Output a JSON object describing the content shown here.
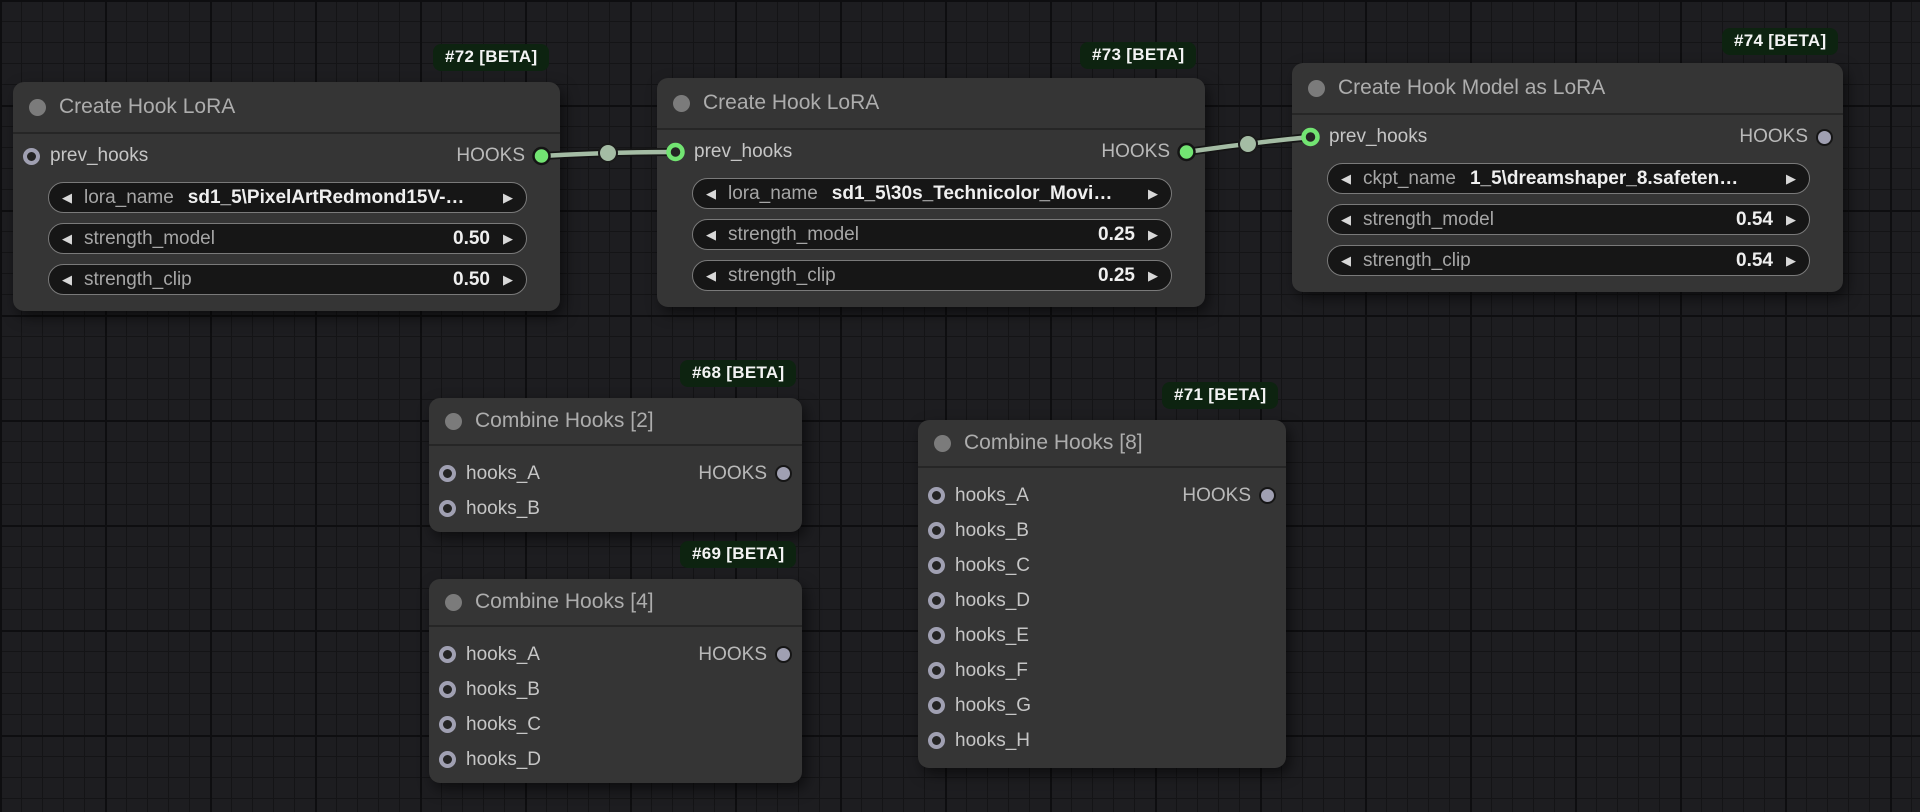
{
  "canvas": {
    "background": "#1d1d20",
    "grid_minor_line": "#141416",
    "grid_major_line": "#0e0e10"
  },
  "colors": {
    "node_bg": "#353535",
    "node_title_text": "#adadad",
    "badge_bg": "#0d2310",
    "badge_text": "#f4f4f4",
    "port_connected_green": "#72e472",
    "port_unconnected_grey": "#a0a0b2",
    "link_color": "#a4bca4",
    "widget_bg": "#161616",
    "widget_border": "#7a7a7a",
    "widget_label_text": "#a6a6a6",
    "widget_value_text": "#efefef",
    "slot_label_text": "#c6c6c6"
  },
  "icons": {
    "arrow_left": "◀",
    "arrow_right": "▶"
  },
  "nodes": [
    {
      "id": "#72",
      "badge": "#72 [BETA]",
      "title": "Create Hook LoRA",
      "inputs": [
        {
          "name": "prev_hooks",
          "connected": false
        }
      ],
      "outputs": [
        {
          "name": "HOOKS",
          "connected": true
        }
      ],
      "widgets": [
        {
          "label": "lora_name",
          "value": "sd1_5\\PixelArtRedmond15V-…",
          "type": "combo"
        },
        {
          "label": "strength_model",
          "value": "0.50",
          "type": "number"
        },
        {
          "label": "strength_clip",
          "value": "0.50",
          "type": "number"
        }
      ]
    },
    {
      "id": "#73",
      "badge": "#73 [BETA]",
      "title": "Create Hook LoRA",
      "inputs": [
        {
          "name": "prev_hooks",
          "connected": true
        }
      ],
      "outputs": [
        {
          "name": "HOOKS",
          "connected": true
        }
      ],
      "widgets": [
        {
          "label": "lora_name",
          "value": "sd1_5\\30s_Technicolor_Movi…",
          "type": "combo"
        },
        {
          "label": "strength_model",
          "value": "0.25",
          "type": "number"
        },
        {
          "label": "strength_clip",
          "value": "0.25",
          "type": "number"
        }
      ]
    },
    {
      "id": "#74",
      "badge": "#74 [BETA]",
      "title": "Create Hook Model as LoRA",
      "inputs": [
        {
          "name": "prev_hooks",
          "connected": true
        }
      ],
      "outputs": [
        {
          "name": "HOOKS",
          "connected": false
        }
      ],
      "widgets": [
        {
          "label": "ckpt_name",
          "value": "1_5\\dreamshaper_8.safeten…",
          "type": "combo"
        },
        {
          "label": "strength_model",
          "value": "0.54",
          "type": "number"
        },
        {
          "label": "strength_clip",
          "value": "0.54",
          "type": "number"
        }
      ]
    },
    {
      "id": "#68",
      "badge": "#68 [BETA]",
      "title": "Combine Hooks [2]",
      "inputs": [
        {
          "name": "hooks_A"
        },
        {
          "name": "hooks_B"
        }
      ],
      "outputs": [
        {
          "name": "HOOKS",
          "connected": false
        }
      ]
    },
    {
      "id": "#69",
      "badge": "#69 [BETA]",
      "title": "Combine Hooks [4]",
      "inputs": [
        {
          "name": "hooks_A"
        },
        {
          "name": "hooks_B"
        },
        {
          "name": "hooks_C"
        },
        {
          "name": "hooks_D"
        }
      ],
      "outputs": [
        {
          "name": "HOOKS",
          "connected": false
        }
      ]
    },
    {
      "id": "#71",
      "badge": "#71 [BETA]",
      "title": "Combine Hooks [8]",
      "inputs": [
        {
          "name": "hooks_A"
        },
        {
          "name": "hooks_B"
        },
        {
          "name": "hooks_C"
        },
        {
          "name": "hooks_D"
        },
        {
          "name": "hooks_E"
        },
        {
          "name": "hooks_F"
        },
        {
          "name": "hooks_G"
        },
        {
          "name": "hooks_H"
        }
      ],
      "outputs": [
        {
          "name": "HOOKS",
          "connected": false
        }
      ]
    }
  ],
  "links": [
    {
      "from": "#72",
      "from_slot": "HOOKS",
      "to": "#73",
      "to_slot": "prev_hooks"
    },
    {
      "from": "#73",
      "from_slot": "HOOKS",
      "to": "#74",
      "to_slot": "prev_hooks"
    }
  ]
}
